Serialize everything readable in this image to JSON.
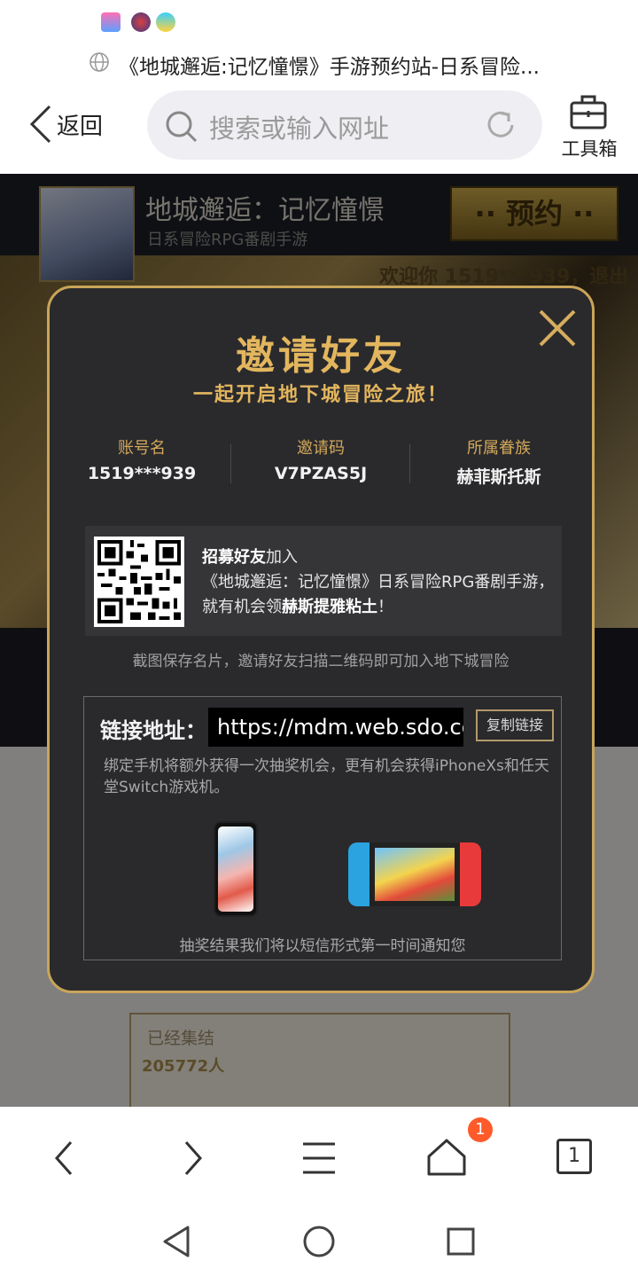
{
  "browser": {
    "page_title": "《地城邂逅:记忆憧憬》手游预约站-日系冒险...",
    "back_label": "返回",
    "search_placeholder": "搜索或输入网址",
    "tools_label": "工具箱",
    "tab_count": "1",
    "home_badge": "1"
  },
  "site": {
    "game_title": "地城邂逅：记忆憧憬",
    "game_subtitle": "日系冒险RPG番剧手游",
    "reserve_label": "·· 预约 ··",
    "welcome": "欢迎你 1519***939，退出",
    "gathered_label": "已经集结",
    "gathered_count": "205772人"
  },
  "modal": {
    "title": "邀请好友",
    "subtitle": "一起开启地下城冒险之旅！",
    "info": [
      {
        "key": "账号名",
        "value": "1519***939"
      },
      {
        "key": "邀请码",
        "value": "V7PZAS5J"
      },
      {
        "key": "所属眷族",
        "value": "赫菲斯托斯"
      }
    ],
    "recruit": {
      "line1_bold": "招募好友",
      "line1_rest": "加入",
      "line2": "《地城邂逅：记忆憧憬》日系冒险RPG番剧手游，",
      "line3_pre": "就有机会领",
      "line3_bold": "赫斯提雅粘土",
      "line3_post": "！"
    },
    "save_hint": "截图保存名片，邀请好友扫描二维码即可加入地下城冒险",
    "link_label": "链接地址：",
    "link_url": "https://mdm.web.sdo.com",
    "copy_label": "复制链接",
    "bind_desc": "绑定手机将额外获得一次抽奖机会，更有机会获得iPhoneXs和任天堂Switch游戏机。",
    "notice": "抽奖结果我们将以短信形式第一时间通知您"
  }
}
